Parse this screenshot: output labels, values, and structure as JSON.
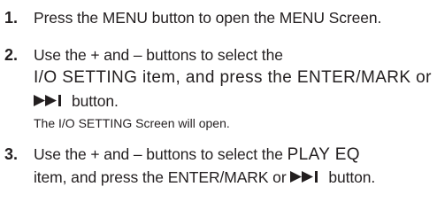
{
  "steps": [
    {
      "number": "1.",
      "lines": {
        "l1": "Press the MENU button to open the MENU Screen."
      }
    },
    {
      "number": "2.",
      "lines": {
        "l1": "Use the + and – buttons to select the",
        "l2": "I/O SETTING item, and press the ENTER/MARK or",
        "l3": "button."
      },
      "note": "The I/O SETTING Screen will open."
    },
    {
      "number": "3.",
      "lines": {
        "l1a": "Use the + and – buttons to select the ",
        "l1b": "PLAY EQ",
        "l2a": "item, and press the ENTER/MARK or ",
        "l2b": "button."
      }
    }
  ],
  "icons": {
    "skip": "play-skip-forward-icon"
  }
}
